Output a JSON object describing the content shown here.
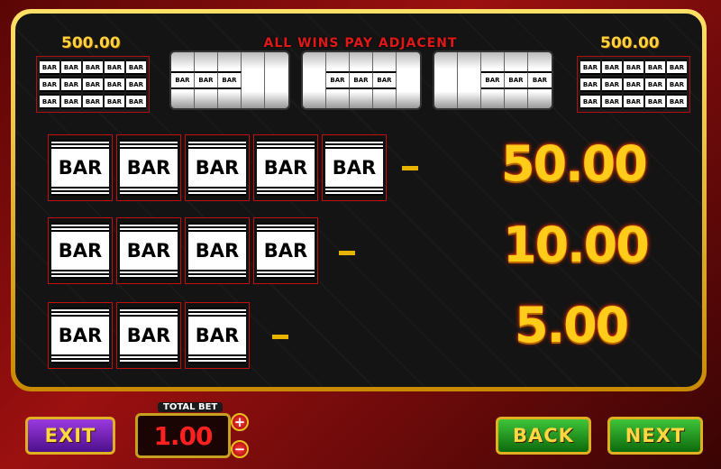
{
  "top": {
    "left_amount": "500.00",
    "right_amount": "500.00",
    "adjacent_title": "ALL WINS PAY ADJACENT",
    "mini_symbol": "BAR",
    "reel_symbol": "BAR"
  },
  "paytable": {
    "symbol_text": "BAR",
    "rows": [
      {
        "count": 5,
        "prize": "50.00"
      },
      {
        "count": 4,
        "prize": "10.00"
      },
      {
        "count": 3,
        "prize": "5.00"
      }
    ]
  },
  "bottom": {
    "exit_label": "EXIT",
    "total_bet_label": "TOTAL BET",
    "total_bet_value": "1.00",
    "plus_label": "+",
    "minus_label": "−",
    "back_label": "BACK",
    "next_label": "NEXT"
  },
  "colors": {
    "gold": "#ffcc1a",
    "exit": "#6a1fb0",
    "nav": "#1a9a1a",
    "bet_text": "#ff2020"
  }
}
